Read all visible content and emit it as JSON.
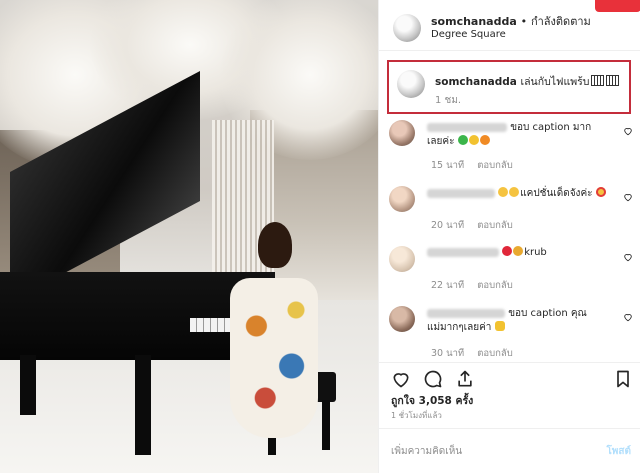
{
  "post": {
    "username": "somchanadda",
    "separator": "•",
    "follow_label": "กำลังติดตาม",
    "location": "Degree Square"
  },
  "caption": {
    "username": "somchanadda",
    "text": "เล่นกับไฟแพร้บ",
    "time": "1 ชม."
  },
  "comments": [
    {
      "text": "ขอบ caption มาก",
      "text2": "เลยค่ะ",
      "emojis": [
        "green-heart",
        "yellow-heart",
        "orange-heart"
      ],
      "time": "15 นาที",
      "reply": "ตอบกลับ"
    },
    {
      "text": "แคปชั่นเด็ดจังค่ะ",
      "emojis_before": [
        "rofl-face",
        "rofl-face"
      ],
      "emojis_after": [
        "heart-eyes-face"
      ],
      "time": "20 นาที",
      "reply": "ตอบกลับ"
    },
    {
      "text": "krub",
      "emojis_before": [
        "red-heart",
        "medal"
      ],
      "time": "22 นาที",
      "reply": "ตอบกลับ"
    },
    {
      "text": "ขอบ caption คุณ",
      "text2": "แม่มากๆเลยค่า",
      "emojis": [
        "clap-hands"
      ],
      "time": "30 นาที",
      "reply": "ตอบกลับ"
    }
  ],
  "likes_text": "ถูกใจ 3,058 ครั้ง",
  "posted_ago": "1 ชั่วโมงที่แล้ว",
  "add_comment_placeholder": "เพิ่มความคิดเห็น",
  "post_button": "โพสต์",
  "colors": {
    "highlight_border": "#c42d3b",
    "header_button": "#e8313a",
    "muted_text": "#8e8e8e"
  }
}
